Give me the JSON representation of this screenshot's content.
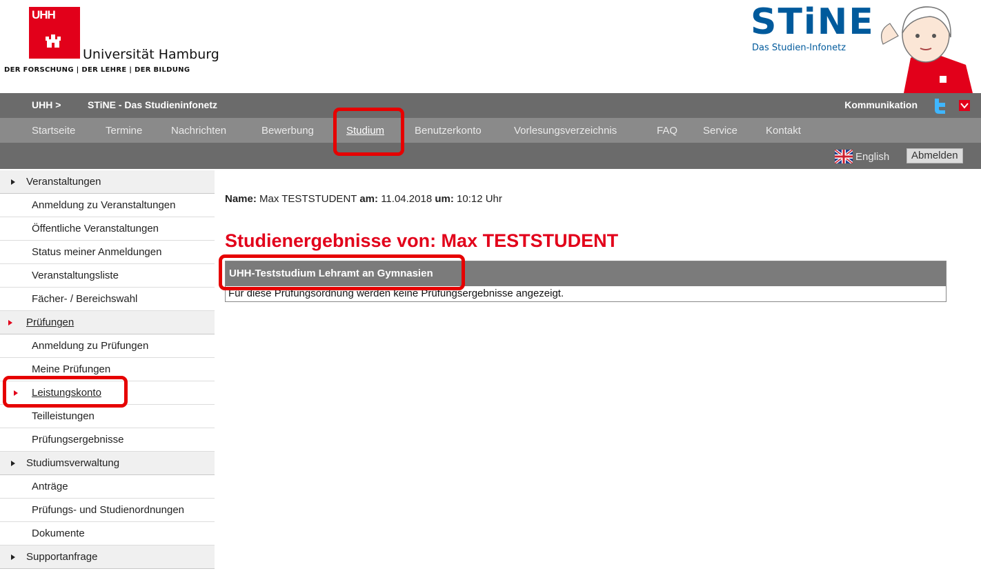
{
  "header": {
    "uhh_mark": "UHH",
    "university_name": "Universität Hamburg",
    "motto": "DER FORSCHUNG | DER LEHRE | DER BILDUNG",
    "stine_logo": "STiNE",
    "stine_subtitle": "Das Studien-Infonetz"
  },
  "topbar": {
    "crumb_uhh": "UHH >",
    "crumb_stine": "STiNE - Das Studieninfonetz",
    "communication": "Kommunikation",
    "icons": [
      "twitter-icon",
      "chevron-down-icon"
    ]
  },
  "nav": {
    "items": [
      {
        "label": "Startseite"
      },
      {
        "label": "Termine"
      },
      {
        "label": "Nachrichten"
      },
      {
        "label": "Bewerbung"
      },
      {
        "label": "Studium",
        "active": true
      },
      {
        "label": "Benutzerkonto"
      },
      {
        "label": "Vorlesungsverzeichnis"
      },
      {
        "label": "FAQ"
      },
      {
        "label": "Service"
      },
      {
        "label": "Kontakt"
      }
    ]
  },
  "subbar": {
    "language_link": "English",
    "logout_label": "Abmelden"
  },
  "sidebar": {
    "items": [
      {
        "label": "Veranstaltungen",
        "type": "section"
      },
      {
        "label": "Anmeldung zu Veranstaltungen"
      },
      {
        "label": "Öffentliche Veranstaltungen"
      },
      {
        "label": "Status meiner Anmeldungen"
      },
      {
        "label": "Veranstaltungsliste"
      },
      {
        "label": "Fächer- / Bereichswahl"
      },
      {
        "label": "Prüfungen",
        "type": "section",
        "open": true
      },
      {
        "label": "Anmeldung zu Prüfungen"
      },
      {
        "label": "Meine Prüfungen"
      },
      {
        "label": "Leistungskonto",
        "active": true
      },
      {
        "label": "Teilleistungen"
      },
      {
        "label": "Prüfungsergebnisse"
      },
      {
        "label": "Studiumsverwaltung",
        "type": "section"
      },
      {
        "label": "Anträge"
      },
      {
        "label": "Prüfungs- und Studienordnungen"
      },
      {
        "label": "Dokumente"
      },
      {
        "label": "Supportanfrage",
        "type": "section"
      }
    ]
  },
  "main": {
    "meta": {
      "name_label": "Name:",
      "name_value": "Max TESTSTUDENT",
      "date_label": "am:",
      "date_value": "11.04.2018",
      "time_label": "um:",
      "time_value": "10:12 Uhr"
    },
    "title": "Studienergebnisse von: Max TESTSTUDENT",
    "table": {
      "header": "UHH-Teststudium Lehramt an Gymnasien",
      "message": "Für diese Prüfungsordnung werden keine Prüfungsergebnisse angezeigt."
    }
  },
  "colors": {
    "brand_red": "#e2001a",
    "stine_blue": "#005a9c",
    "bar_dark": "#6b6b6b",
    "bar_mid": "#8a8a8a",
    "highlight": "#e60000"
  }
}
